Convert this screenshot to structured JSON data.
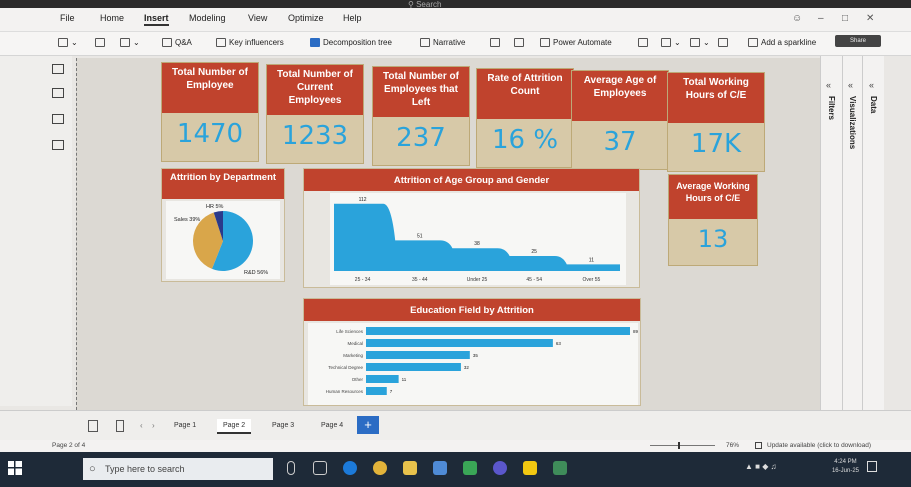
{
  "title_bar": {
    "search": "Search"
  },
  "menu": {
    "items": [
      "File",
      "Home",
      "Insert",
      "Modeling",
      "View",
      "Optimize",
      "Help"
    ],
    "active": "Insert"
  },
  "ribbon": {
    "qa": "Q&A",
    "key_influencers": "Key influencers",
    "decomposition_tree": "Decomposition tree",
    "narrative": "Narrative",
    "power_automate": "Power Automate",
    "sparkline": "Add a sparkline",
    "share": "Share"
  },
  "kpis": [
    {
      "title": "Total Number of Employee",
      "value": "1470"
    },
    {
      "title": "Total Number of Current Employees",
      "value": "1233"
    },
    {
      "title": "Total Number of Employees that Left",
      "value": "237"
    },
    {
      "title": "Rate of Attrition Count",
      "value": "16 %"
    },
    {
      "title": "Average Age of Employees",
      "value": "37"
    },
    {
      "title": "Total Working Hours of C/E",
      "value": "17K"
    }
  ],
  "avg_hours": {
    "title": "Average Working Hours of C/E",
    "value": "13"
  },
  "pie_panel": {
    "title": "Attrition by Department"
  },
  "age_panel": {
    "title": "Attrition of Age Group and Gender"
  },
  "edu_panel": {
    "title": "Education Field by Attrition"
  },
  "chart_data": [
    {
      "type": "pie",
      "title": "Attrition by Department",
      "categories": [
        "R&D",
        "Sales",
        "HR"
      ],
      "values": [
        56,
        39,
        5
      ],
      "labels": [
        "R&D 56%",
        "Sales 39%",
        "HR 5%"
      ],
      "colors": [
        "#2aa3db",
        "#d9a64a",
        "#2b3a8a"
      ]
    },
    {
      "type": "area",
      "title": "Attrition of Age Group and Gender",
      "categories": [
        "25 - 34",
        "35 - 44",
        "Under 25",
        "45 - 54",
        "Over 55"
      ],
      "values": [
        112,
        51,
        38,
        25,
        11
      ],
      "color": "#2aa3db"
    },
    {
      "type": "bar",
      "orientation": "horizontal",
      "title": "Education Field by Attrition",
      "categories": [
        "Life Sciences",
        "Medical",
        "Marketing",
        "Technical Degree",
        "Other",
        "Human Resources"
      ],
      "values": [
        89,
        63,
        35,
        32,
        11,
        7
      ],
      "color": "#2aa3db"
    }
  ],
  "right_panes": {
    "filters": "Filters",
    "visualizations": "Visualizations",
    "data": "Data"
  },
  "pages": {
    "tabs": [
      "Page 1",
      "Page 2",
      "Page 3",
      "Page 4"
    ],
    "active": "Page 2",
    "add": "+"
  },
  "status": {
    "page": "Page 2 of 4",
    "zoom": "76%",
    "update": "Update available (click to download)"
  },
  "taskbar": {
    "search_placeholder": "Type here to search",
    "time": "4:24 PM",
    "date": "16-Jun-25"
  }
}
